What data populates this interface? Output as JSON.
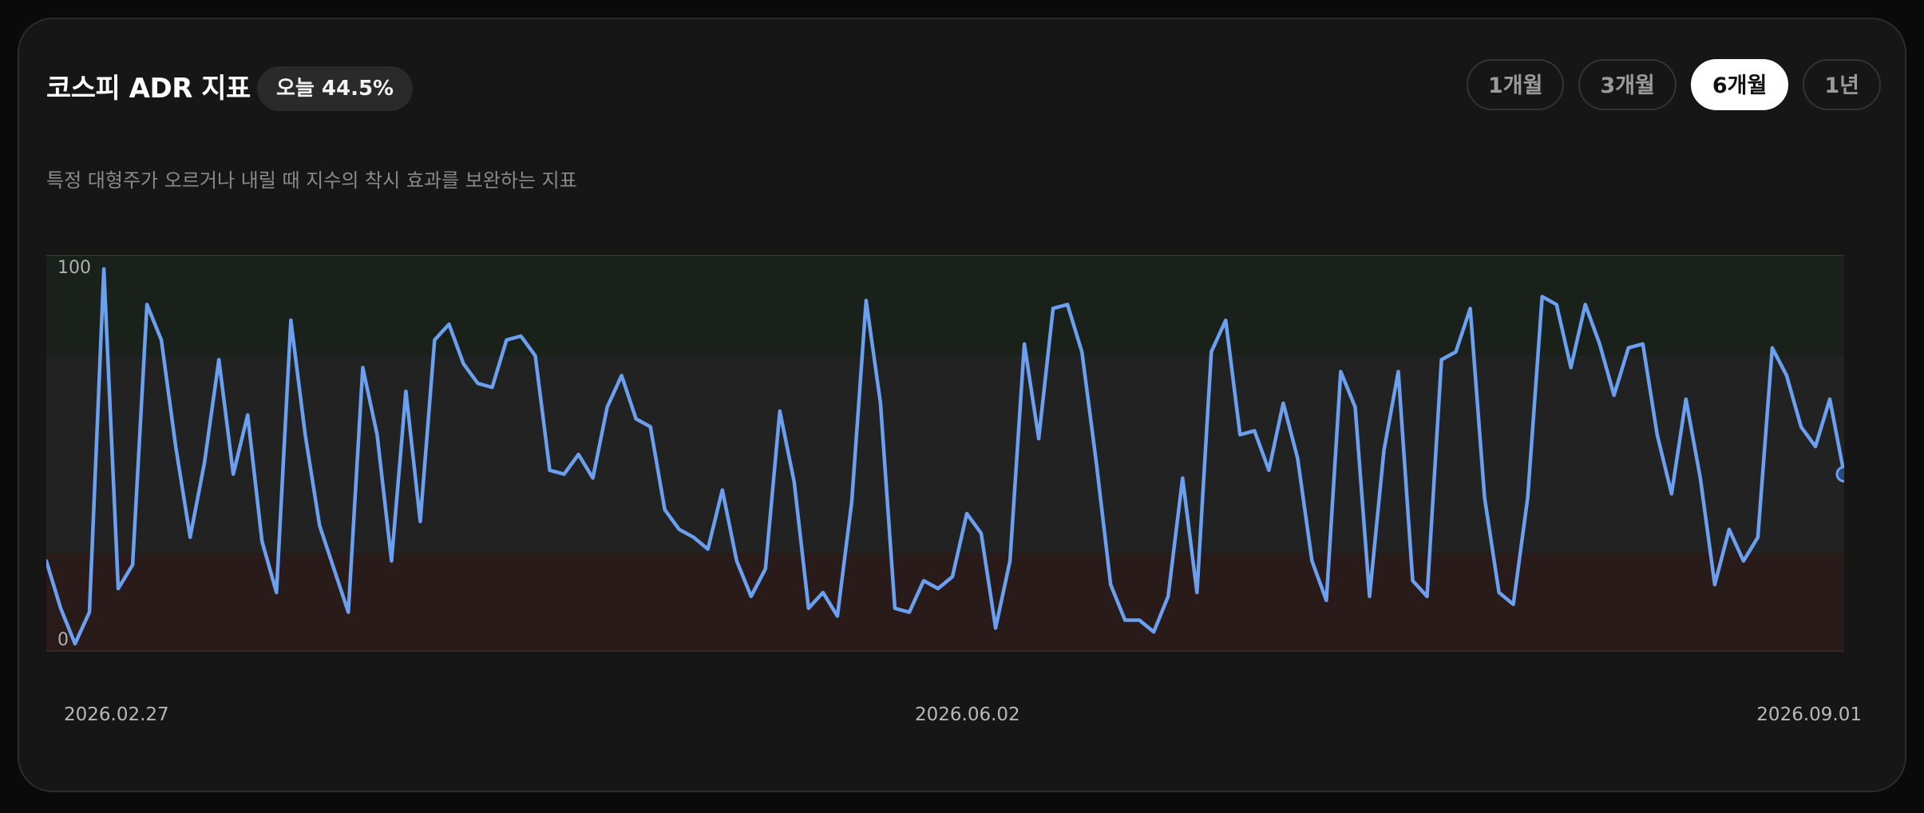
{
  "header": {
    "title": "코스피 ADR 지표",
    "today_badge": "오늘 44.5%",
    "description": "특정 대형주가 오르거나 내릴 때 지수의 착시 효과를 보완하는 지표"
  },
  "tabs": [
    {
      "label": "1개월",
      "active": false
    },
    {
      "label": "3개월",
      "active": false
    },
    {
      "label": "6개월",
      "active": true
    },
    {
      "label": "1년",
      "active": false
    }
  ],
  "colors": {
    "line": "#6b9ff0",
    "upper_zone": "#1a211b",
    "middle_zone": "#222222",
    "lower_zone": "#2a1b1b",
    "marker_fill": "#2a4a7a"
  },
  "chart_data": {
    "type": "line",
    "title": "",
    "xlabel": "",
    "ylabel": "",
    "ylim": [
      0,
      100
    ],
    "y_tick_labels": [
      "100",
      "0"
    ],
    "x_tick_labels": [
      "2026.02.27",
      "2026.06.02",
      "2026.09.01"
    ],
    "zones": [
      {
        "from": 75,
        "to": 100,
        "label": ""
      },
      {
        "from": 25,
        "to": 75,
        "label": ""
      },
      {
        "from": 0,
        "to": 25,
        "label": ""
      }
    ],
    "grid": false,
    "legend": "none",
    "series": [
      {
        "values": [
          23,
          11,
          2,
          10,
          97,
          16,
          22,
          88,
          79,
          52,
          29,
          48,
          74,
          45,
          60,
          28,
          15,
          84,
          55,
          32,
          21,
          10,
          72,
          55,
          23,
          66,
          33,
          79,
          83,
          73,
          68,
          67,
          79,
          80,
          75,
          46,
          45,
          50,
          44,
          62,
          70,
          59,
          57,
          36,
          31,
          29,
          26,
          41,
          23,
          14,
          21,
          61,
          43,
          11,
          15,
          9,
          38,
          89,
          63,
          11,
          10,
          18,
          16,
          19,
          35,
          30,
          6,
          23,
          78,
          54,
          87,
          88,
          76,
          48,
          17,
          8,
          8,
          5,
          14,
          44,
          15,
          76,
          84,
          55,
          56,
          46,
          63,
          49,
          23,
          13,
          71,
          62,
          14,
          51,
          71,
          18,
          14,
          74,
          76,
          87,
          39,
          15,
          12,
          39,
          90,
          88,
          72,
          88,
          78,
          65,
          77,
          78,
          55,
          40,
          64,
          44,
          17,
          31,
          23,
          29,
          77,
          70,
          57,
          52,
          64,
          45
        ]
      }
    ]
  }
}
